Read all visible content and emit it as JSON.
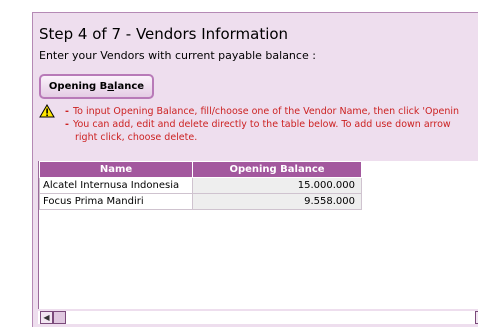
{
  "header": {
    "title": "Step 4 of 7  - Vendors Information",
    "subtitle": "Enter your Vendors with current payable balance :"
  },
  "toolbar": {
    "opening_balance_pre": "Opening B",
    "opening_balance_accel": "a",
    "opening_balance_post": "lance"
  },
  "notes": [
    "To input Opening Balance, fill/choose one of the Vendor Name, then click 'Openin",
    "You can add, edit and delete directly to the table below. To add use down arrow",
    "right click, choose delete."
  ],
  "table": {
    "columns": [
      "Name",
      "Opening Balance"
    ],
    "rows": [
      {
        "name": "Alcatel Internusa Indonesia",
        "balance": "15.000.000"
      },
      {
        "name": "Focus Prima Mandiri",
        "balance": "9.558.000"
      }
    ]
  },
  "scrollbar": {
    "left_arrow": "◀"
  },
  "colors": {
    "panel_bg": "#eedeee",
    "header_bg": "#a3589e",
    "note_text": "#cc2222",
    "button_border": "#b87ab8"
  },
  "icons": {
    "warning": "warning-icon"
  }
}
